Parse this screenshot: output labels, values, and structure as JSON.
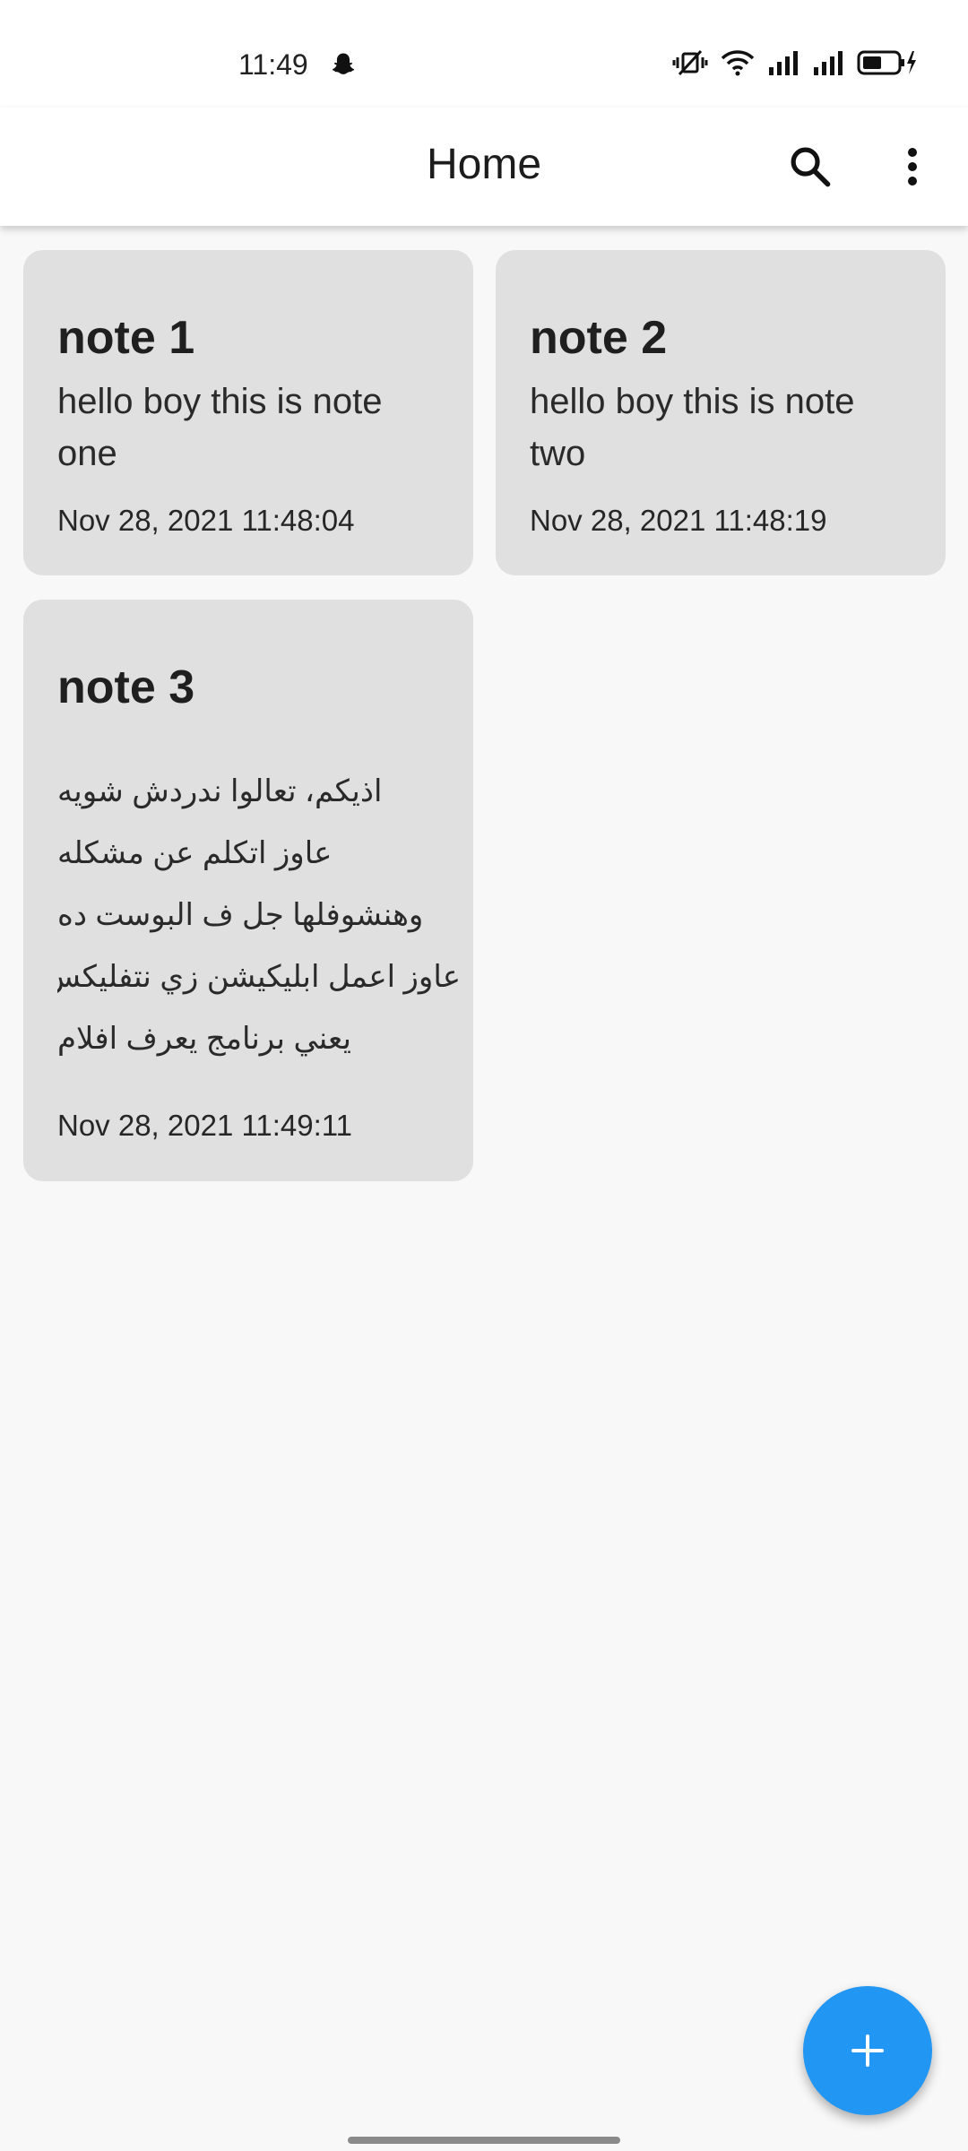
{
  "status_bar": {
    "time": "11:49",
    "icons": [
      "snapchat-ghost-icon",
      "vibrate-icon",
      "wifi-icon",
      "signal-1-icon",
      "signal-2-icon",
      "battery-charging-icon"
    ]
  },
  "app_bar": {
    "title": "Home",
    "actions": [
      "search-icon",
      "more-vert-icon"
    ]
  },
  "notes": [
    {
      "title": "note 1",
      "body": "hello boy this is note one",
      "date": "Nov 28, 2021  11:48:04"
    },
    {
      "title": "note 2",
      "body": "hello boy this is note two",
      "date": "Nov 28, 2021  11:48:19"
    },
    {
      "title": "note 3",
      "body_lines": [
        "اذيكم، تعالوا ندردش شويه",
        "عاوز اتكلم عن مشكله",
        "وهنشوفلها جل ف البوست ده",
        "عاوز اعمل ابليكيشن زي نتفليكس",
        "يعني برنامج يعرف افلام"
      ],
      "date": "Nov 28, 2021  11:49:11"
    }
  ],
  "fab": {
    "icon": "plus-icon"
  },
  "colors": {
    "background": "#f8f8f8",
    "app_bar": "#ffffff",
    "card": "#e0e0e0",
    "fab": "#2196f3"
  }
}
